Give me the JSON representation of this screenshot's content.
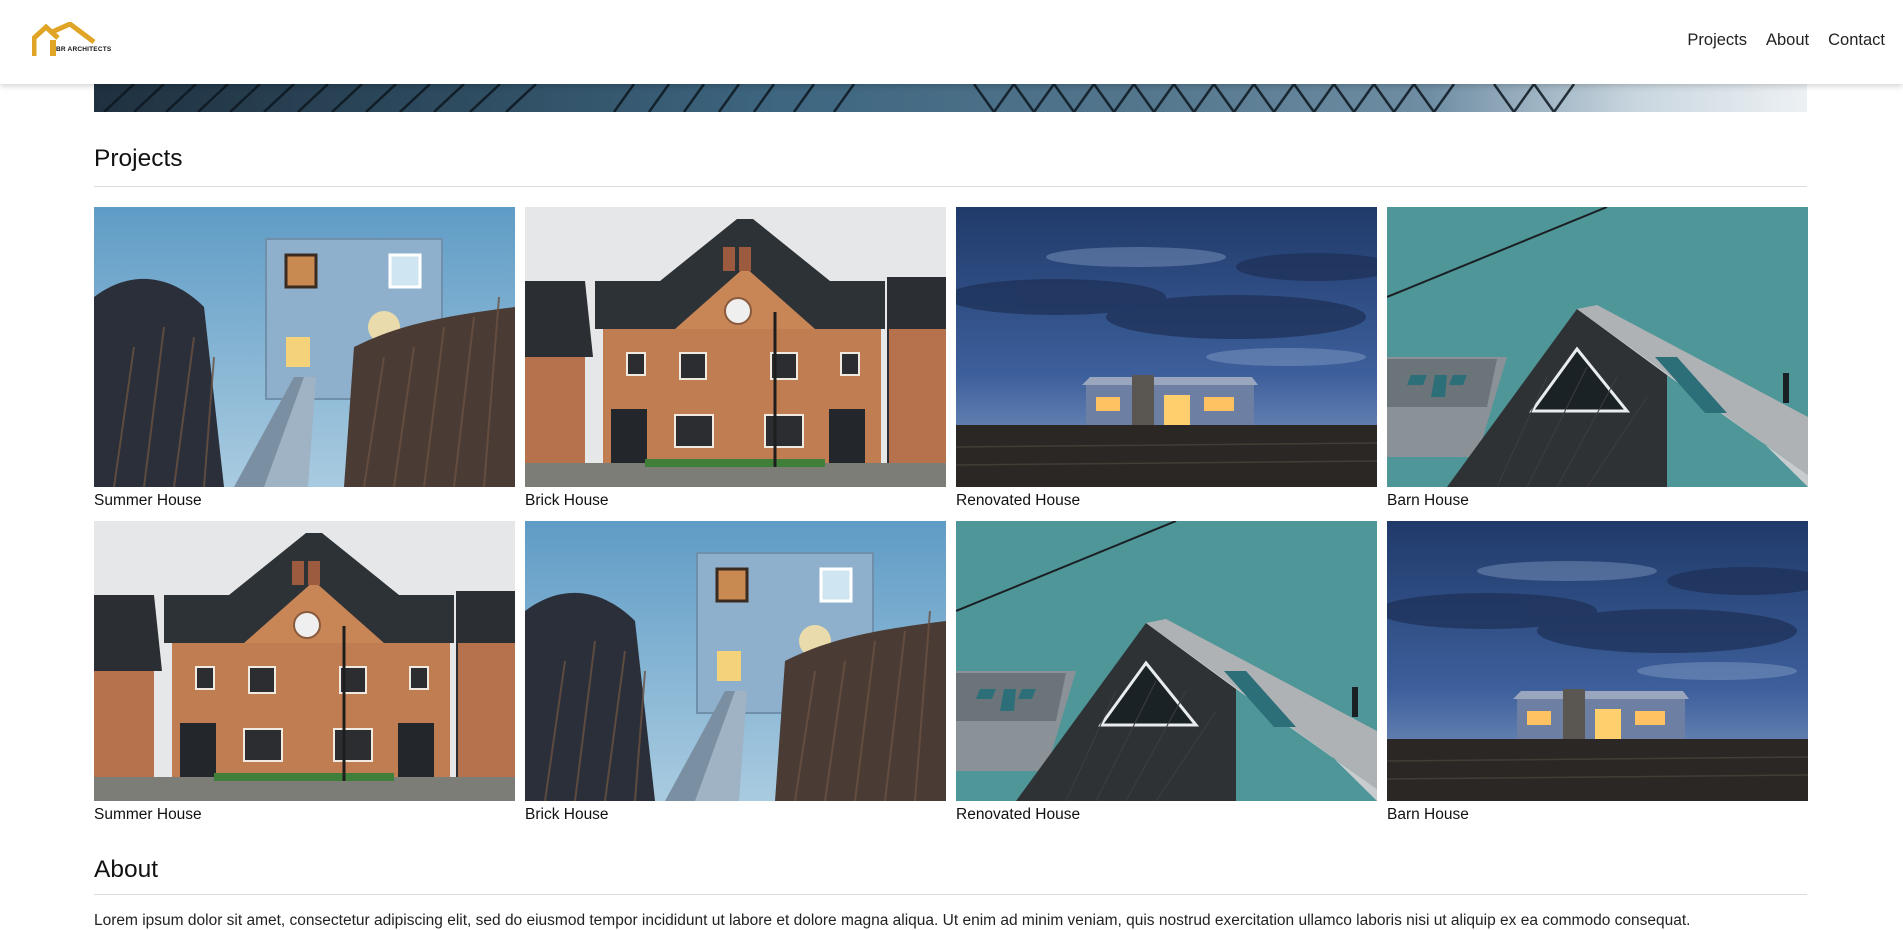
{
  "header": {
    "logo_text": "BR ARCHITECTS",
    "brand_color": "#e0a526",
    "nav": [
      "Projects",
      "About",
      "Contact"
    ]
  },
  "projects": {
    "title": "Projects",
    "items": [
      {
        "caption": "Summer House",
        "photo": "summer-house-photo"
      },
      {
        "caption": "Brick House",
        "photo": "brick-house-photo"
      },
      {
        "caption": "Renovated House",
        "photo": "renovated-house-photo"
      },
      {
        "caption": "Barn House",
        "photo": "barn-house-photo"
      },
      {
        "caption": "Summer House",
        "photo": "brick-house-photo"
      },
      {
        "caption": "Brick House",
        "photo": "summer-house-photo"
      },
      {
        "caption": "Renovated House",
        "photo": "barn-house-photo"
      },
      {
        "caption": "Barn House",
        "photo": "renovated-house-photo"
      }
    ]
  },
  "about": {
    "title": "About",
    "text": "Lorem ipsum dolor sit amet, consectetur adipiscing elit, sed do eiusmod tempor incididunt ut labore et dolore magna aliqua. Ut enim ad minim veniam, quis nostrud exercitation ullamco laboris nisi ut aliquip ex ea commodo consequat."
  }
}
